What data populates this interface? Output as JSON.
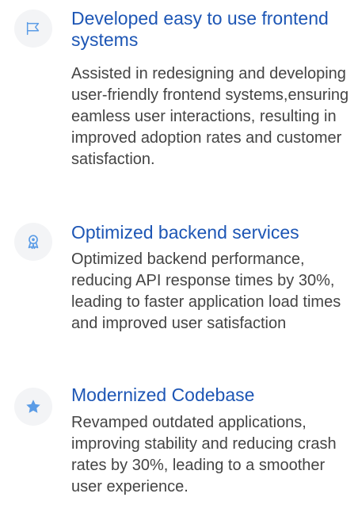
{
  "items": [
    {
      "icon": "flag-icon",
      "title": "Developed easy to use frontend systems",
      "description": "Assisted in redesigning and developing user-friendly frontend systems,ensuring eamless user interactions, resulting in improved adoption rates and customer satisfaction."
    },
    {
      "icon": "award-icon",
      "title": "Optimized backend services",
      "description": "Optimized backend performance, reducing API response times by 30%, leading to faster application load times and improved user satisfaction"
    },
    {
      "icon": "star-icon",
      "title": "Modernized Codebase",
      "description": "Revamped outdated applications, improving stability and reducing crash rates by 30%, leading to a smoother user experience."
    }
  ],
  "colors": {
    "title": "#1d56b5",
    "icon": "#5b9ce6",
    "icon_bg": "#f3f4f6",
    "body_text": "#444444"
  }
}
